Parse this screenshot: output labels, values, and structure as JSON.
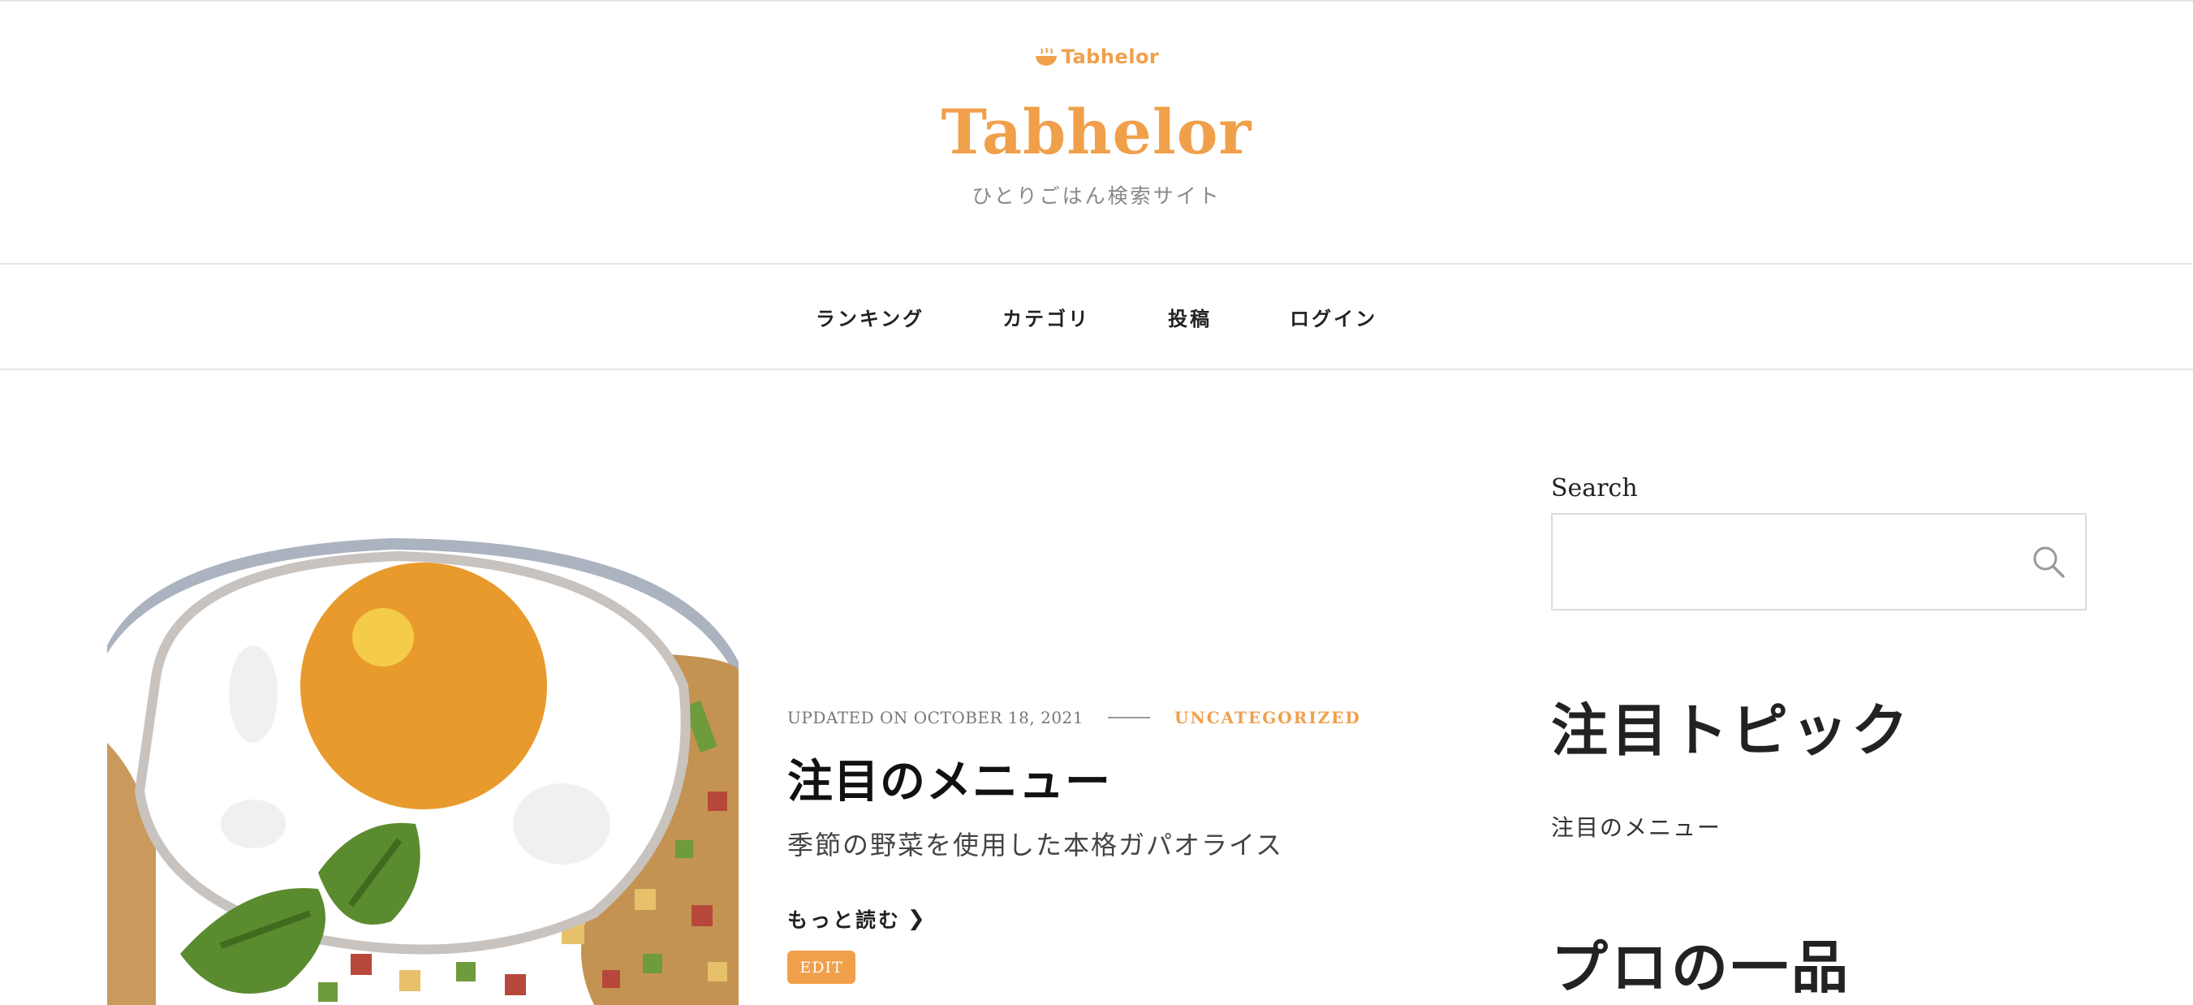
{
  "header": {
    "logo_text": "Tabhelor",
    "site_title": "Tabhelor",
    "tagline": "ひとりごはん検索サイト"
  },
  "nav": {
    "items": [
      {
        "label": "ランキング"
      },
      {
        "label": "カテゴリ"
      },
      {
        "label": "投稿"
      },
      {
        "label": "ログイン"
      }
    ]
  },
  "post": {
    "updated": "UPDATED ON OCTOBER 18, 2021",
    "category": "UNCATEGORIZED",
    "title": "注目のメニュー",
    "excerpt": "季節の野菜を使用した本格ガパオライス",
    "read_more": "もっと読む",
    "edit_label": "EDIT"
  },
  "sidebar": {
    "search_label": "Search",
    "search_value": "",
    "widget1_title": "注目トピック",
    "widget1_link": "注目のメニュー",
    "widget2_title": "プロの一品"
  },
  "colors": {
    "accent": "#f0a04b",
    "text": "#222222",
    "border": "#e6e6e6"
  },
  "icons": [
    "bowl-icon",
    "search-icon",
    "chevron-right-icon"
  ]
}
